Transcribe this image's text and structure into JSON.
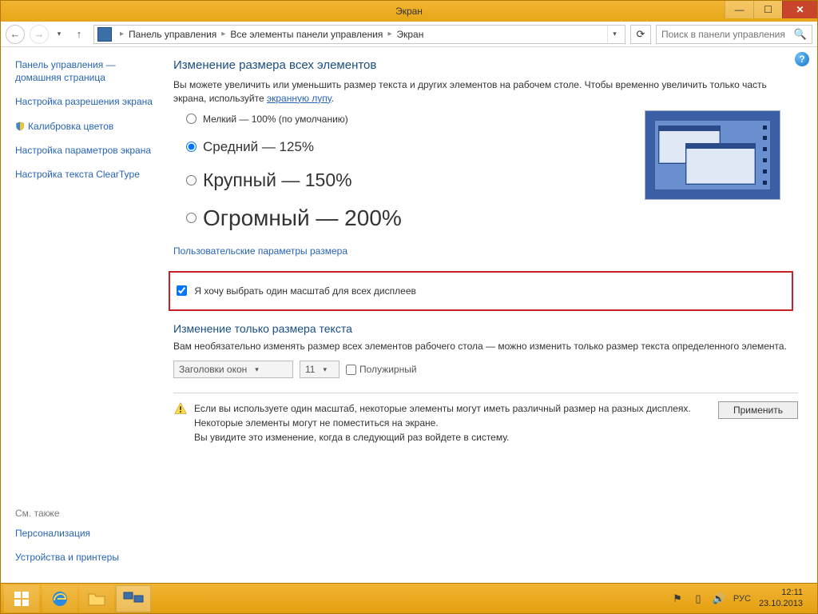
{
  "window": {
    "title": "Экран"
  },
  "nav": {
    "breadcrumb": [
      "Панель управления",
      "Все элементы панели управления",
      "Экран"
    ],
    "search_placeholder": "Поиск в панели управления"
  },
  "sidebar": {
    "links": [
      "Панель управления — домашняя страница",
      "Настройка разрешения экрана",
      "Калибровка цветов",
      "Настройка параметров экрана",
      "Настройка текста ClearType"
    ],
    "see_also_heading": "См. также",
    "see_also": [
      "Персонализация",
      "Устройства и принтеры"
    ]
  },
  "main": {
    "heading_resize": "Изменение размера всех элементов",
    "intro_1": "Вы можете увеличить или уменьшить размер текста и других элементов на рабочем столе. Чтобы временно увеличить только часть экрана, используйте ",
    "intro_link": "экранную лупу",
    "intro_2": ".",
    "options": [
      {
        "label": "Мелкий — 100% (по умолчанию)",
        "checked": false
      },
      {
        "label": "Средний — 125%",
        "checked": true
      },
      {
        "label": "Крупный — 150%",
        "checked": false
      },
      {
        "label": "Огромный — 200%",
        "checked": false
      }
    ],
    "custom_link": "Пользовательские параметры размера",
    "checkbox_all": "Я хочу выбрать один масштаб для всех дисплеев",
    "heading_text": "Изменение только размера текста",
    "text_intro": "Вам необязательно изменять размер всех элементов рабочего стола — можно изменить только размер текста определенного элемента.",
    "select_element": "Заголовки окон",
    "select_size": "11",
    "bold_label": "Полужирный",
    "warning_line1": "Если вы используете один масштаб, некоторые элементы могут иметь различный размер на разных дисплеях.",
    "warning_line2": "Некоторые элементы могут не поместиться на экране.",
    "warning_line3": "Вы увидите это изменение, когда в следующий раз войдете в систему.",
    "apply": "Применить"
  },
  "taskbar": {
    "lang": "РУС",
    "time": "12:11",
    "date": "23.10.2013"
  }
}
